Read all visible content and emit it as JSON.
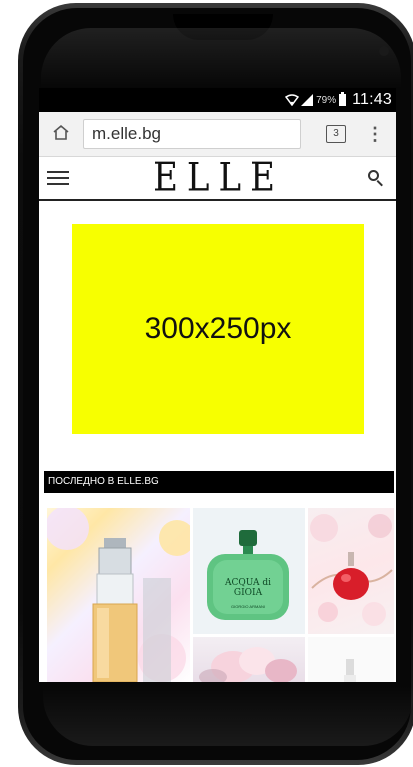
{
  "status_bar": {
    "battery": "79%",
    "time": "11:43"
  },
  "browser": {
    "url": "m.elle.bg",
    "tab_count": "3"
  },
  "site": {
    "logo": "ELLE"
  },
  "ad": {
    "label": "300x250px"
  },
  "section": {
    "title": "ПОСЛЕДНО В ELLE.BG"
  },
  "thumbnails": [
    {
      "bottle_text": ""
    },
    {
      "bottle_text": "ACQUA di GIOIA",
      "brand": "GIORGIO ARMANI"
    },
    {
      "bottle_text": ""
    },
    {
      "bottle_text": ""
    },
    {
      "bottle_text": ""
    }
  ],
  "colors": {
    "ad_background": "#f7ff00",
    "section_bar": "#000000",
    "accent_dark": "#111111"
  }
}
